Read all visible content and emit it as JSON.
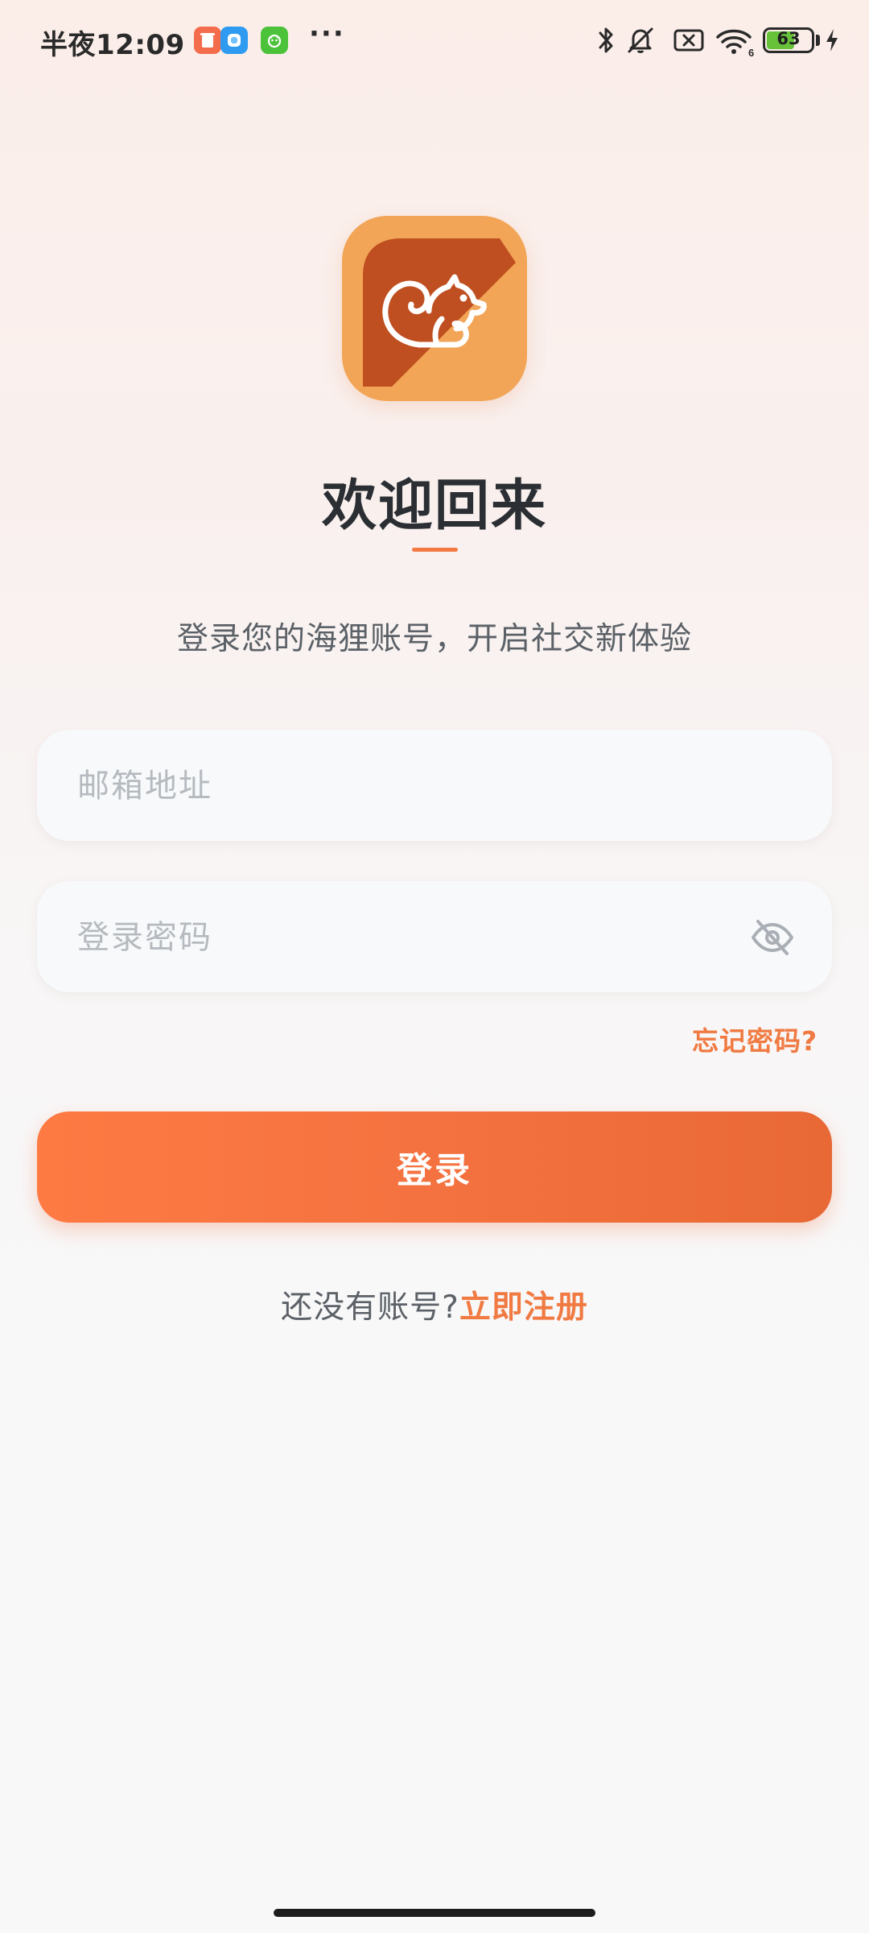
{
  "status_bar": {
    "time": "半夜12:09",
    "more": "···",
    "battery_level": "63",
    "battery_fraction": 0.63,
    "notification_icons": [
      "red-app-icon",
      "blue-app-icon",
      "green-app-icon"
    ],
    "system_icons": [
      "bluetooth-icon",
      "muted-bell-icon",
      "no-sim-icon",
      "wifi-icon",
      "battery-icon",
      "charging-icon"
    ],
    "wifi_badge": "6"
  },
  "colors": {
    "accent": "#f37a42",
    "logo_light": "#f2a556",
    "logo_dark": "#bf4f20",
    "text_primary": "#2b2f33",
    "text_secondary": "#5b6167",
    "placeholder": "#b5babf"
  },
  "login": {
    "logo_icon": "squirrel-icon",
    "title": "欢迎回来",
    "subtitle": "登录您的海狸账号，开启社交新体验",
    "email": {
      "placeholder": "邮箱地址",
      "value": ""
    },
    "password": {
      "placeholder": "登录密码",
      "value": "",
      "toggle_icon": "eye-off-icon"
    },
    "forgot_label": "忘记密码?",
    "submit_label": "登录",
    "register_prompt": "还没有账号?",
    "register_link": "立即注册"
  }
}
